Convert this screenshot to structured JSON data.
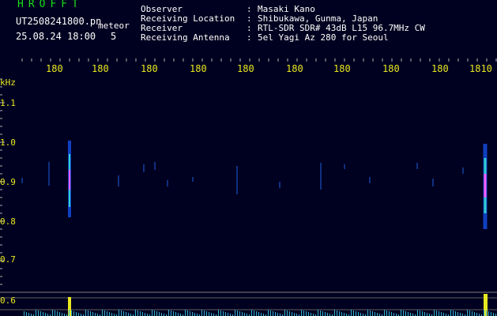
{
  "header": {
    "brand": "HROFFT",
    "filename": "UT2508241800.pn",
    "kind": "meteor",
    "datetime": "25.08.24 18:00",
    "count": "5",
    "info": [
      {
        "label": "Observer",
        "colon": ":",
        "value": "Masaki Kano"
      },
      {
        "label": "Receiving Location",
        "colon": ":",
        "value": "Shibukawa, Gunma, Japan"
      },
      {
        "label": "Receiver",
        "colon": ":",
        "value": "RTL-SDR SDR# 43dB L15 96.7MHz CW"
      },
      {
        "label": "Receiving Antenna",
        "colon": ":",
        "value": "5el Yagi Az 280 for Seoul"
      }
    ]
  },
  "x_axis": {
    "ticks": [
      "180",
      "180",
      "180",
      "180",
      "180",
      "180",
      "180",
      "180",
      "180",
      "1810"
    ]
  },
  "y_axis": {
    "unit": "kHz",
    "ticks": [
      "1.1",
      "1.0",
      "0.9",
      "0.8",
      "0.7",
      "0.6"
    ]
  },
  "colors": {
    "background": "#000020",
    "text_header": "#ffffff",
    "text_brand": "#18e018",
    "axis_text": "#e8e820",
    "signal_strong": "#e8e820",
    "signal_weak": "#2080ff"
  }
}
